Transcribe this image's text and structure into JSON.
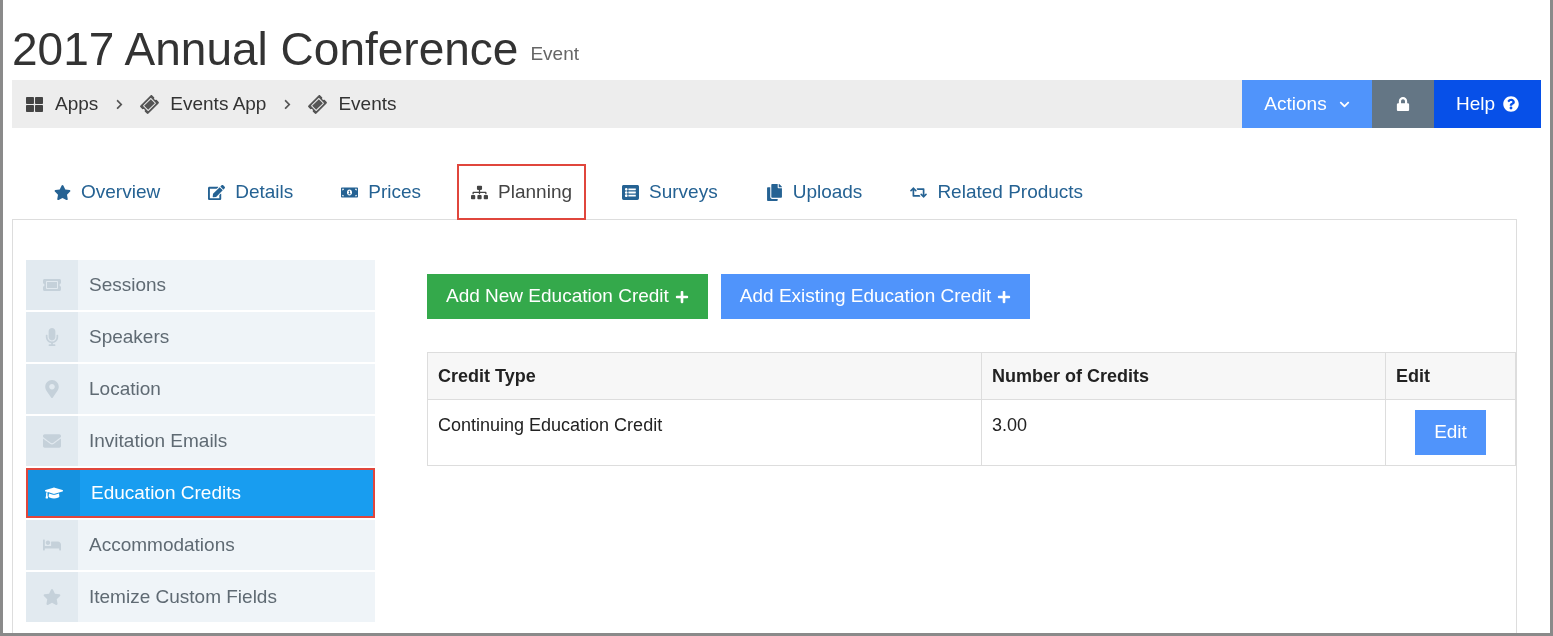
{
  "title": "2017 Annual Conference",
  "subtitle": "Event",
  "breadcrumb": [
    "Apps",
    "Events App",
    "Events"
  ],
  "actions": {
    "label": "Actions",
    "help": "Help"
  },
  "tabs": [
    {
      "label": "Overview",
      "selected": false
    },
    {
      "label": "Details",
      "selected": false
    },
    {
      "label": "Prices",
      "selected": false
    },
    {
      "label": "Planning",
      "selected": true
    },
    {
      "label": "Surveys",
      "selected": false
    },
    {
      "label": "Uploads",
      "selected": false
    },
    {
      "label": "Related Products",
      "selected": false
    }
  ],
  "sidebar": {
    "items": [
      {
        "label": "Sessions",
        "selected": false
      },
      {
        "label": "Speakers",
        "selected": false
      },
      {
        "label": "Location",
        "selected": false
      },
      {
        "label": "Invitation Emails",
        "selected": false
      },
      {
        "label": "Education Credits",
        "selected": true
      },
      {
        "label": "Accommodations",
        "selected": false
      },
      {
        "label": "Itemize Custom Fields",
        "selected": false
      }
    ]
  },
  "buttons": [
    {
      "label": "Add New Education Credit",
      "kind": "success"
    },
    {
      "label": "Add Existing Education Credit",
      "kind": "primary"
    }
  ],
  "table": {
    "columns": [
      "Credit Type",
      "Number of Credits",
      "Edit"
    ],
    "rows": [
      {
        "credit_type": "Continuing Education Credit",
        "number": "3.00",
        "edit": "Edit"
      }
    ]
  }
}
